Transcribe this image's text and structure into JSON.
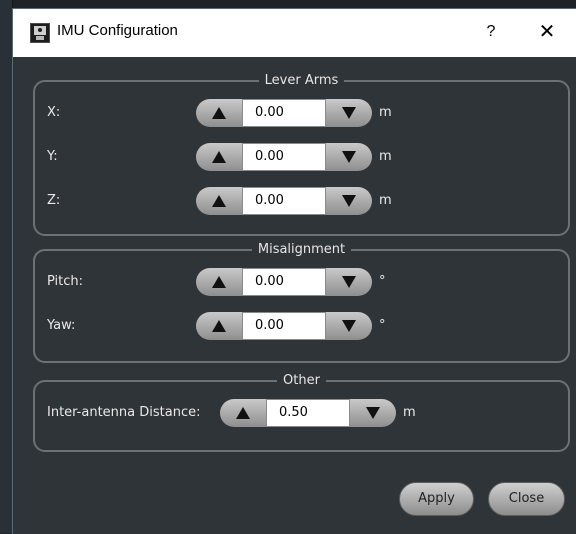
{
  "dialog": {
    "title": "IMU Configuration",
    "help_label": "?",
    "close_label": "✕",
    "app_icon": "app-logo-icon"
  },
  "groups": {
    "lever_arms": {
      "title": "Lever Arms",
      "rows": [
        {
          "label": "X:",
          "value": "0.00",
          "unit": "m"
        },
        {
          "label": "Y:",
          "value": "0.00",
          "unit": "m"
        },
        {
          "label": "Z:",
          "value": "0.00",
          "unit": "m"
        }
      ]
    },
    "misalignment": {
      "title": "Misalignment",
      "rows": [
        {
          "label": "Pitch:",
          "value": "0.00",
          "unit": "°"
        },
        {
          "label": "Yaw:",
          "value": "0.00",
          "unit": "°"
        }
      ]
    },
    "other": {
      "title": "Other",
      "rows": [
        {
          "label": "Inter-antenna Distance:",
          "value": "0.50",
          "unit": "m"
        }
      ]
    }
  },
  "spinner_icons": {
    "decrement": "triangle-up-icon",
    "increment": "triangle-down-icon"
  },
  "buttons": {
    "apply": "Apply",
    "close": "Close"
  },
  "colors": {
    "dialog_bg": "#2f3439",
    "titlebar_bg": "#ffffff",
    "group_border": "#6c7177",
    "button_gradient_top": "#cfcfcf",
    "button_gradient_bottom": "#8d8d8d"
  }
}
